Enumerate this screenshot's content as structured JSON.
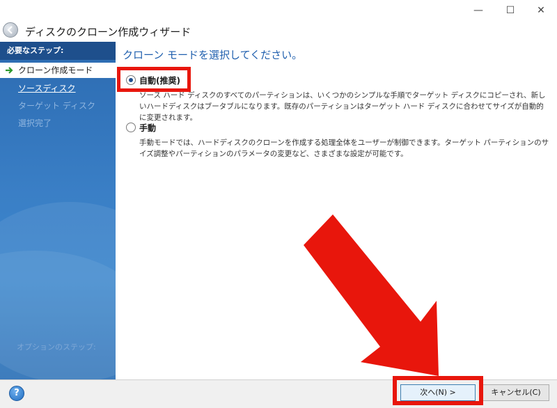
{
  "window": {
    "title": "ディスクのクローン作成ウィザード",
    "controls": {
      "minimize": "—",
      "maximize": "☐",
      "close": "✕"
    }
  },
  "sidebar": {
    "heading": "必要なステップ:",
    "items": [
      {
        "label": "クローン作成モード",
        "state": "current"
      },
      {
        "label": "ソースディスク",
        "state": "link"
      },
      {
        "label": "ターゲット ディスク",
        "state": "disabled"
      },
      {
        "label": "選択完了",
        "state": "disabled"
      }
    ],
    "optional_steps": "オプションのステップ:"
  },
  "main": {
    "heading": "クローン モードを選択してください。",
    "options": [
      {
        "label": "自動(推奨)",
        "selected": true,
        "description": "ソース ハード ディスクのすべてのパーティションは、いくつかのシンプルな手順でターゲット ディスクにコピーされ、新しいハードディスクはブータブルになります。既存のパーティションはターゲット ハード ディスクに合わせてサイズが自動的に変更されます。"
      },
      {
        "label": "手動",
        "selected": false,
        "description": "手動モードでは、ハードディスクのクローンを作成する処理全体をユーザーが制御できます。ターゲット パーティションのサイズ調整やパーティションのパラメータの変更など、さまざまな設定が可能です。"
      }
    ]
  },
  "footer": {
    "help": "?",
    "next_label": "次へ(N) >",
    "cancel_label": "キャンセル(C)"
  },
  "annotations": {
    "highlight_color": "#e8160c"
  }
}
